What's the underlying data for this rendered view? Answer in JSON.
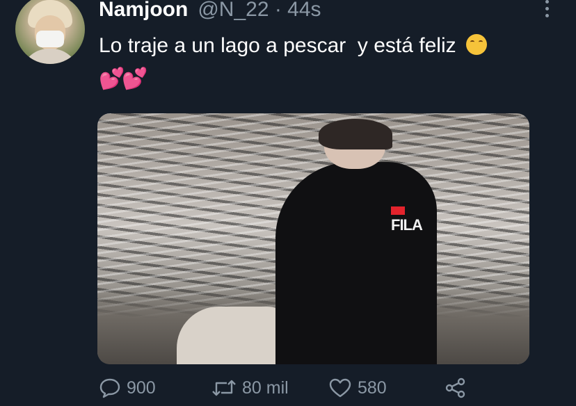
{
  "tweet": {
    "author_name": "Namjoon",
    "handle_time": "@N_22 · 44s",
    "text": "Lo traje a un lago a pescar  y está feliz",
    "hearts": "💕💕",
    "media_logo_text": "FILA"
  },
  "actions": {
    "reply_count": "900",
    "retweet_count": "80 mil",
    "like_count": "580"
  },
  "icons": {
    "reply": "speech-bubble-icon",
    "retweet": "retweet-icon",
    "like": "heart-icon",
    "share": "share-icon",
    "more": "more-vertical-icon",
    "emoji_smile": "smiling-face-emoji",
    "emoji_hearts": "two-hearts-emoji"
  },
  "colors": {
    "background": "#151d28",
    "secondary_text": "#8b98a5",
    "primary_text": "#ffffff"
  }
}
